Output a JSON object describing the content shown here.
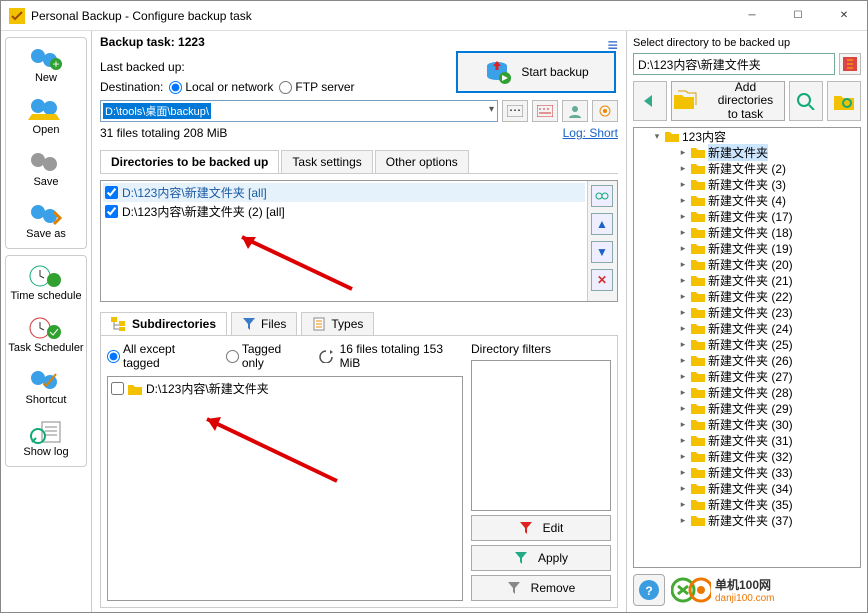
{
  "window": {
    "title": "Personal Backup - Configure backup task"
  },
  "sidebar": {
    "group1": [
      {
        "label": "New"
      },
      {
        "label": "Open"
      },
      {
        "label": "Save"
      },
      {
        "label": "Save as"
      }
    ],
    "group2": [
      {
        "label": "Time schedule"
      },
      {
        "label": "Task Scheduler"
      },
      {
        "label": "Shortcut"
      },
      {
        "label": "Show log"
      }
    ]
  },
  "center": {
    "task_label": "Backup task:",
    "task_name": "1223",
    "last_backed_up": "Last backed up:",
    "start_backup": "Start backup",
    "destination_label": "Destination:",
    "radio_local": "Local or network",
    "radio_ftp": "FTP server",
    "dest_path": "D:\\tools\\桌面\\backup\\",
    "stats": "31 files totaling 208 MiB",
    "log_link": "Log: Short",
    "tabs": [
      {
        "label": "Directories to be backed up"
      },
      {
        "label": "Task settings"
      },
      {
        "label": "Other options"
      }
    ],
    "dirs": [
      {
        "path": "D:\\123内容\\新建文件夹 [all]",
        "selected": true
      },
      {
        "path": "D:\\123内容\\新建文件夹 (2) [all]",
        "selected": false
      }
    ],
    "subtabs": [
      {
        "label": "Subdirectories"
      },
      {
        "label": "Files"
      },
      {
        "label": "Types"
      }
    ],
    "filter_all": "All except tagged",
    "filter_tagged": "Tagged only",
    "sub_stats": "16 files totaling 153 MiB",
    "subdir": "D:\\123内容\\新建文件夹",
    "filters_label": "Directory filters",
    "btn_edit": "Edit",
    "btn_apply": "Apply",
    "btn_remove": "Remove"
  },
  "right": {
    "label": "Select directory to be backed up",
    "path": "D:\\123内容\\新建文件夹",
    "add_btn": "Add directories\nto task",
    "root": "123内容",
    "folders": [
      "新建文件夹",
      "新建文件夹 (2)",
      "新建文件夹 (3)",
      "新建文件夹 (4)",
      "新建文件夹 (17)",
      "新建文件夹 (18)",
      "新建文件夹 (19)",
      "新建文件夹 (20)",
      "新建文件夹 (21)",
      "新建文件夹 (22)",
      "新建文件夹 (23)",
      "新建文件夹 (24)",
      "新建文件夹 (25)",
      "新建文件夹 (26)",
      "新建文件夹 (27)",
      "新建文件夹 (28)",
      "新建文件夹 (29)",
      "新建文件夹 (30)",
      "新建文件夹 (31)",
      "新建文件夹 (32)",
      "新建文件夹 (33)",
      "新建文件夹 (34)",
      "新建文件夹 (35)",
      "新建文件夹 (37)"
    ],
    "brand_text": "单机100网",
    "brand_url": "danji100.com"
  }
}
